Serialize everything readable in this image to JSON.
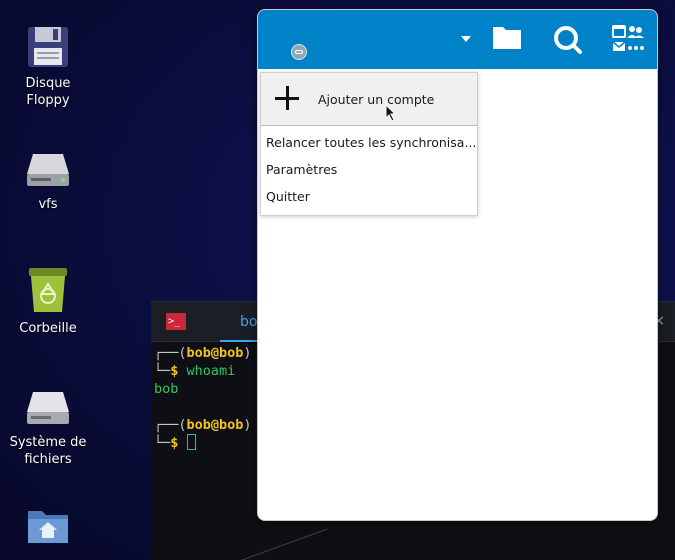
{
  "desktop": {
    "icons": [
      {
        "label_line1": "Disque",
        "label_line2": "Floppy",
        "icon": "floppy-disk-icon"
      },
      {
        "label_line1": "vfs",
        "label_line2": "",
        "icon": "drive-icon"
      },
      {
        "label_line1": "Corbeille",
        "label_line2": "",
        "icon": "trash-icon"
      },
      {
        "label_line1": "Système de",
        "label_line2": "fichiers",
        "icon": "filesystem-icon"
      },
      {
        "label_line1": "",
        "label_line2": "",
        "icon": "home-folder-icon"
      }
    ]
  },
  "terminal": {
    "tab_label": "bob@",
    "close_glyph": "×",
    "prompt_user": "bob@bob",
    "lines": {
      "command1": "whoami",
      "output1": "bob"
    }
  },
  "nextcloud": {
    "menu": {
      "add_account": "Ajouter un compte",
      "items": [
        "Relancer toutes les synchronisa...",
        "Paramètres",
        "Quitter"
      ]
    },
    "colors": {
      "header": "#0082c9"
    }
  },
  "colors": {
    "desktop_bg": "#0a0c3a",
    "terminal_accent": "#3ea6e8",
    "prompt_yellow": "#f0c419",
    "command_green": "#2ec95c"
  }
}
